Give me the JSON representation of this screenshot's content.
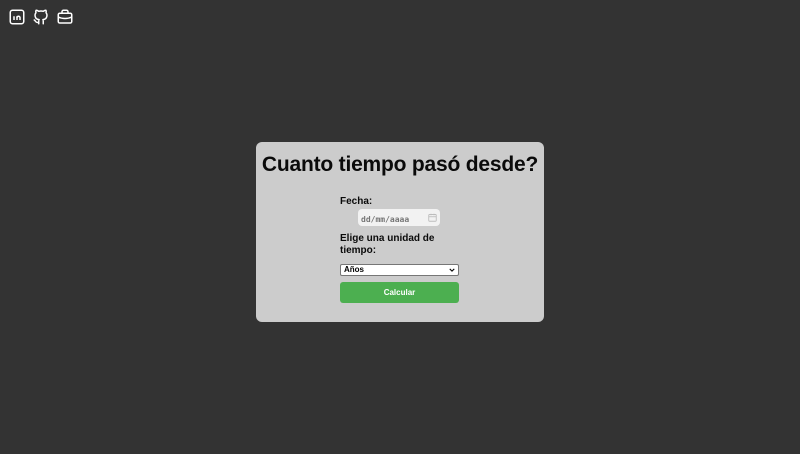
{
  "social": [
    {
      "icon": "linkedin-icon"
    },
    {
      "icon": "github-icon"
    },
    {
      "icon": "briefcase-icon"
    }
  ],
  "card": {
    "title": "Cuanto tiempo pasó desde?",
    "date_label": "Fecha:",
    "date_placeholder": "dd/mm/aaaa",
    "unit_label": "Elige una unidad de tiempo:",
    "unit_selected": "Años",
    "submit_label": "Calcular"
  },
  "colors": {
    "background": "#333333",
    "card": "#cccccc",
    "button": "#4caf50"
  }
}
